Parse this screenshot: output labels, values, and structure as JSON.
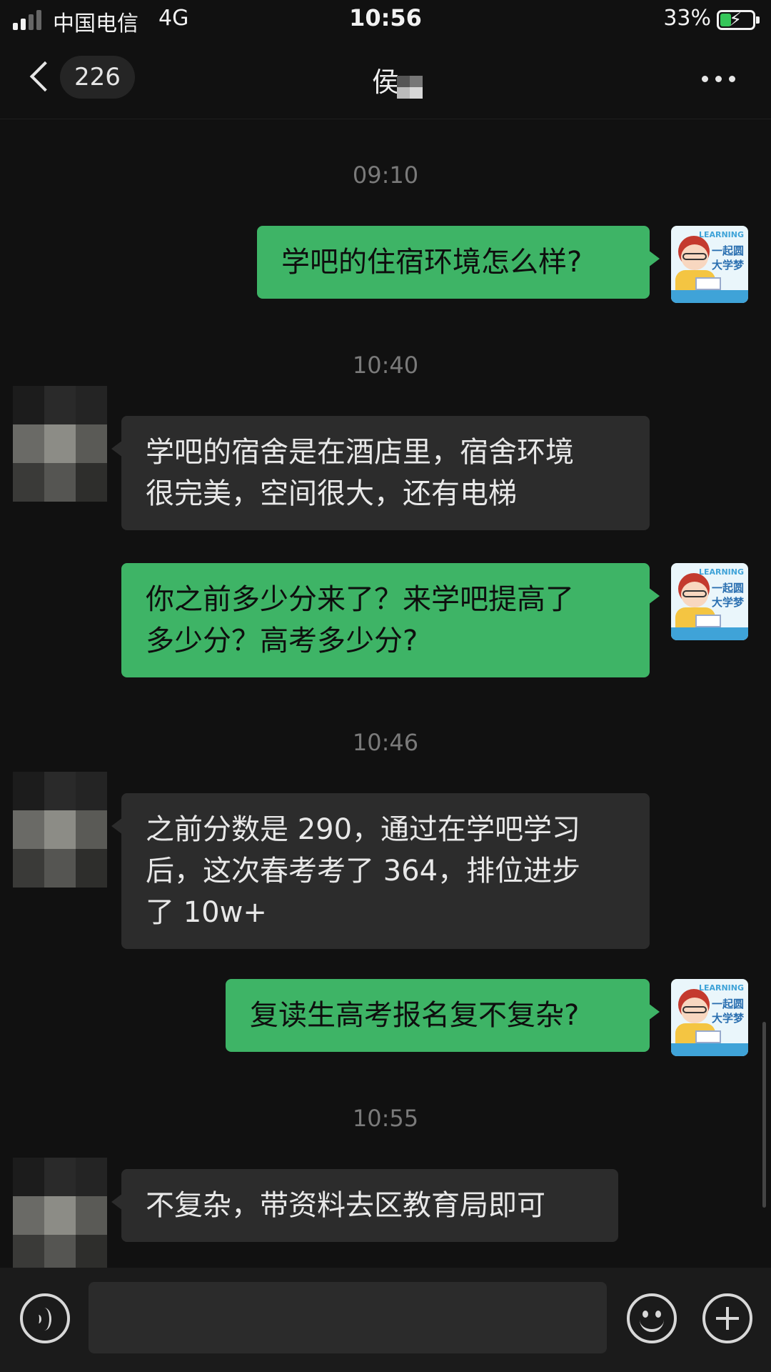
{
  "status_bar": {
    "carrier": "中国电信",
    "network": "4G",
    "time": "10:56",
    "battery_percent": "33%",
    "battery_level": 0.33,
    "battery_color": "#35c759"
  },
  "nav": {
    "back_icon": "chevron-left-icon",
    "unread_count": "226",
    "title": "侯",
    "more_icon": "more-dots-icon"
  },
  "messages": [
    {
      "type": "time",
      "text": "09:10"
    },
    {
      "type": "sent",
      "text": "学吧的住宿环境怎么样?"
    },
    {
      "type": "time",
      "text": "10:40"
    },
    {
      "type": "received",
      "lines": [
        "学吧的宿舍是在酒店里，宿舍环境",
        "很完美，空间很大，还有电梯"
      ]
    },
    {
      "type": "sent",
      "lines": [
        "你之前多少分来了？来学吧提高了",
        "多少分？高考多少分?"
      ]
    },
    {
      "type": "time",
      "text": "10:46"
    },
    {
      "type": "received",
      "lines": [
        "之前分数是 290，通过在学吧学习",
        "后，这次春考考了 364，排位进步",
        "了 10w+"
      ]
    },
    {
      "type": "sent",
      "text": "复读生高考报名复不复杂?"
    },
    {
      "type": "time",
      "text": "10:55"
    },
    {
      "type": "received",
      "text": "不复杂，带资料去区教育局即可"
    }
  ],
  "my_avatar": {
    "tag": "LEARNING",
    "line1": "一起圆",
    "line2": "大学梦"
  },
  "input_bar": {
    "voice_icon": "voice-icon",
    "placeholder": "",
    "emoji_icon": "emoji-icon",
    "plus_icon": "plus-icon"
  },
  "colors": {
    "sent_bubble": "#3eb466",
    "received_bubble": "#2c2c2c",
    "background": "#111111"
  }
}
